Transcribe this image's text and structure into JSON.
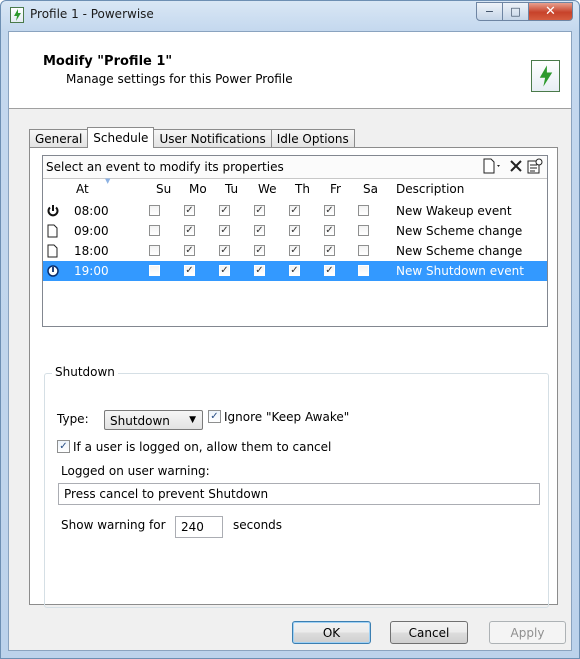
{
  "window": {
    "title": "Profile 1 - Powerwise",
    "controls": {
      "minimize": "−",
      "maximize": "□",
      "close": "✕"
    }
  },
  "header": {
    "title": "Modify \"Profile 1\"",
    "subtitle": "Manage settings for this Power Profile"
  },
  "tabs": [
    {
      "label": "General",
      "active": false
    },
    {
      "label": "Schedule",
      "active": true
    },
    {
      "label": "User Notifications",
      "active": false
    },
    {
      "label": "Idle Options",
      "active": false
    }
  ],
  "schedule": {
    "prompt": "Select an event to modify its properties",
    "toolbar": {
      "new_icon": "new-document-icon",
      "delete_icon": "delete-icon",
      "properties_icon": "properties-icon"
    },
    "columns": {
      "at": "At",
      "su": "Su",
      "mo": "Mo",
      "tu": "Tu",
      "we": "We",
      "th": "Th",
      "fr": "Fr",
      "sa": "Sa",
      "description": "Description"
    },
    "events": [
      {
        "icon": "power-icon",
        "time": "08:00",
        "days": [
          false,
          true,
          true,
          true,
          true,
          true,
          false
        ],
        "description": "New Wakeup event",
        "selected": false
      },
      {
        "icon": "document-icon",
        "time": "09:00",
        "days": [
          false,
          true,
          true,
          true,
          true,
          true,
          false
        ],
        "description": "New Scheme change",
        "selected": false
      },
      {
        "icon": "document-icon",
        "time": "18:00",
        "days": [
          false,
          true,
          true,
          true,
          true,
          true,
          false
        ],
        "description": "New Scheme change",
        "selected": false
      },
      {
        "icon": "shutdown-icon",
        "time": "19:00",
        "days": [
          false,
          true,
          true,
          true,
          true,
          true,
          false
        ],
        "description": "New Shutdown event",
        "selected": true
      }
    ]
  },
  "shutdown": {
    "legend": "Shutdown",
    "type_label": "Type:",
    "type_value": "Shutdown",
    "ignore_keep_awake_label": "Ignore \"Keep Awake\"",
    "ignore_keep_awake_checked": true,
    "allow_cancel_label": "If a user is logged on, allow them to cancel",
    "allow_cancel_checked": true,
    "warning_label": "Logged on user warning:",
    "warning_value": "Press cancel to prevent Shutdown",
    "show_warning_label": "Show warning for",
    "show_warning_value": "240",
    "seconds_label": "seconds"
  },
  "buttons": {
    "ok": "OK",
    "cancel": "Cancel",
    "apply": "Apply"
  },
  "colors": {
    "selection": "#3399ff",
    "brand_green": "#2e9a2e"
  }
}
